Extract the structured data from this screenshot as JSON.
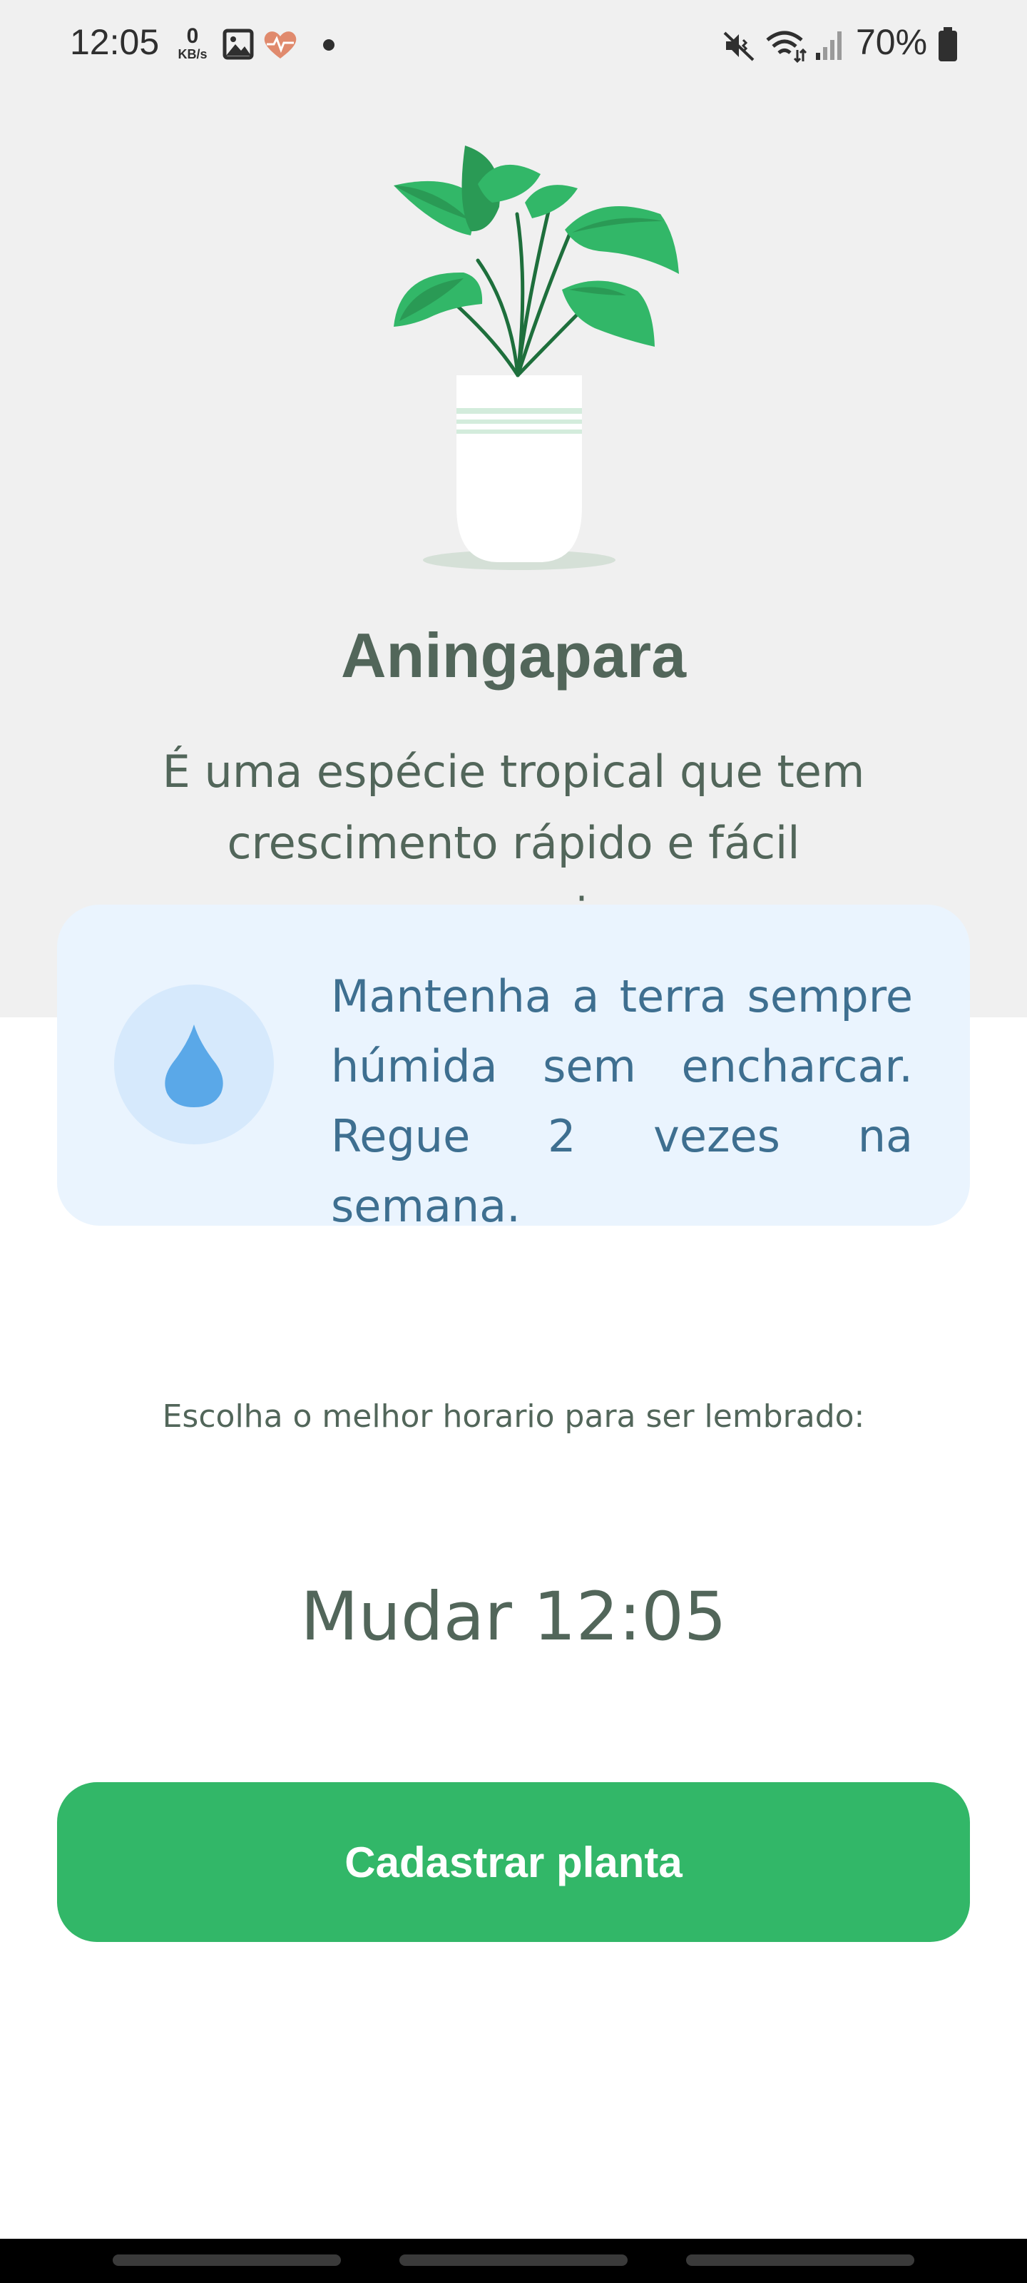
{
  "status_bar": {
    "time": "12:05",
    "net_speed_value": "0",
    "net_speed_unit": "KB/s",
    "battery": "70%",
    "icons": [
      "gallery-icon",
      "health-heart-icon",
      "dot-icon",
      "mute-vibrate-icon",
      "wifi-icon",
      "signal-icon",
      "battery-icon"
    ]
  },
  "plant": {
    "name": "Aningapara",
    "description": "É uma espécie tropical que tem crescimento rápido e fácil manuseio.",
    "icon": "potted-plant-illustration"
  },
  "tip": {
    "icon": "water-drop-icon",
    "text": "Mantenha a terra sempre húmida sem encharcar. Regue 2 vezes na semana."
  },
  "reminder": {
    "label": "Escolha o melhor horario para ser lembrado:",
    "change_time_label": "Mudar 12:05"
  },
  "actions": {
    "register_label": "Cadastrar planta"
  },
  "colors": {
    "primary_green": "#32b768",
    "heading_text": "#52665a",
    "tip_background": "#eaf4fe",
    "tip_text": "#3e6f90",
    "water_blue": "#5aa8e8",
    "top_background": "#f0f0f0"
  }
}
